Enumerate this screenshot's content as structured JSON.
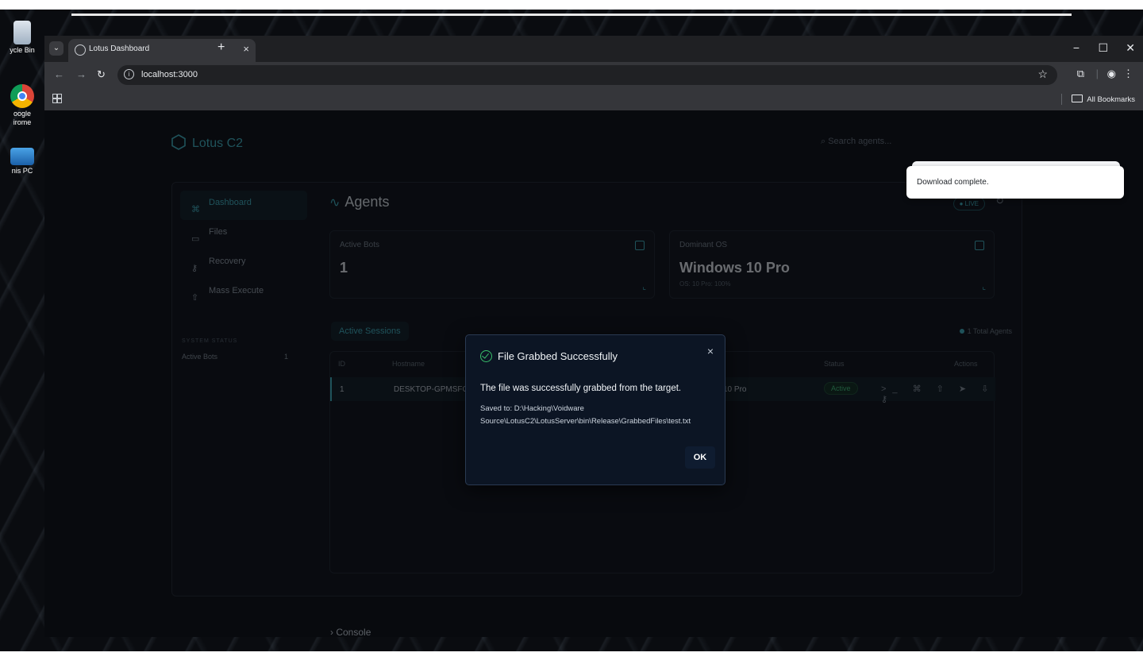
{
  "desktop": {
    "icons": [
      {
        "label": "ycle Bin"
      },
      {
        "label": "oogle\nirome"
      },
      {
        "label": "nis PC"
      }
    ]
  },
  "browser": {
    "tab_title": "Lotus Dashboard",
    "url": "localhost:3000",
    "bookmarks_label": "All Bookmarks"
  },
  "app": {
    "brand": "Lotus C2",
    "search_placeholder": "Search agents...",
    "nav": [
      "Dashboard",
      "Files",
      "Recovery",
      "Mass Execute"
    ],
    "system_status_label": "SYSTEM STATUS",
    "system_status_row": {
      "label": "Active Bots",
      "value": "1"
    },
    "page_title": "Agents",
    "live_badge": "● LIVE",
    "cards": [
      {
        "label": "Active Bots",
        "value": "1",
        "sub": ""
      },
      {
        "label": "Dominant OS",
        "value": "Windows 10 Pro",
        "sub": "OS: 10 Pro: 100%"
      }
    ],
    "sessions_tab": "Active Sessions",
    "total_agents": "1 Total Agents",
    "table": {
      "headers": [
        "ID",
        "Hostname",
        "Status",
        "Actions"
      ],
      "row": {
        "id": "1",
        "hostname": "DESKTOP-GPMSFO",
        "os": "ws 10 Pro",
        "status": "Active"
      }
    },
    "console_label": "Console"
  },
  "toast": {
    "message": "Download complete."
  },
  "modal": {
    "title": "File Grabbed Successfully",
    "body": "The file was successfully grabbed from the target.",
    "path_line1": "Saved to: D:\\Hacking\\Voidware",
    "path_line2": "Source\\LotusC2\\LotusServer\\bin\\Release\\GrabbedFiles\\test.txt",
    "ok_label": "OK"
  }
}
